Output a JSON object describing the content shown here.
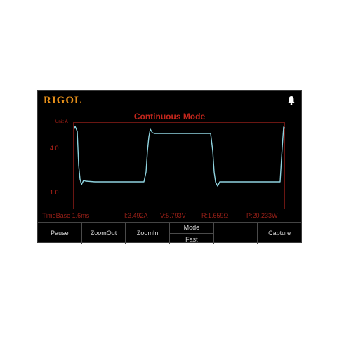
{
  "brand": "RIGOL",
  "icons": {
    "bell": "bell-icon"
  },
  "title": "Continuous Mode",
  "axis": {
    "unit_label": "Unit: A",
    "ticks": [
      "4.0",
      "1.0"
    ]
  },
  "status": {
    "timebase": "TimeBase 1.6ms",
    "current": "I:3.492A",
    "voltage": "V:5.793V",
    "resistance": "R:1.659Ω",
    "power": "P:20.233W"
  },
  "menu": {
    "pause": "Pause",
    "zoom_out": "ZoomOut",
    "zoom_in": "ZoomIn",
    "mode_label": "Mode",
    "mode_value": "Fast",
    "capture": "Capture"
  },
  "colors": {
    "logo": "#e7901a",
    "title": "#c3261c",
    "waveform": "#8fd3df",
    "grid_border": "#6a1612"
  }
}
